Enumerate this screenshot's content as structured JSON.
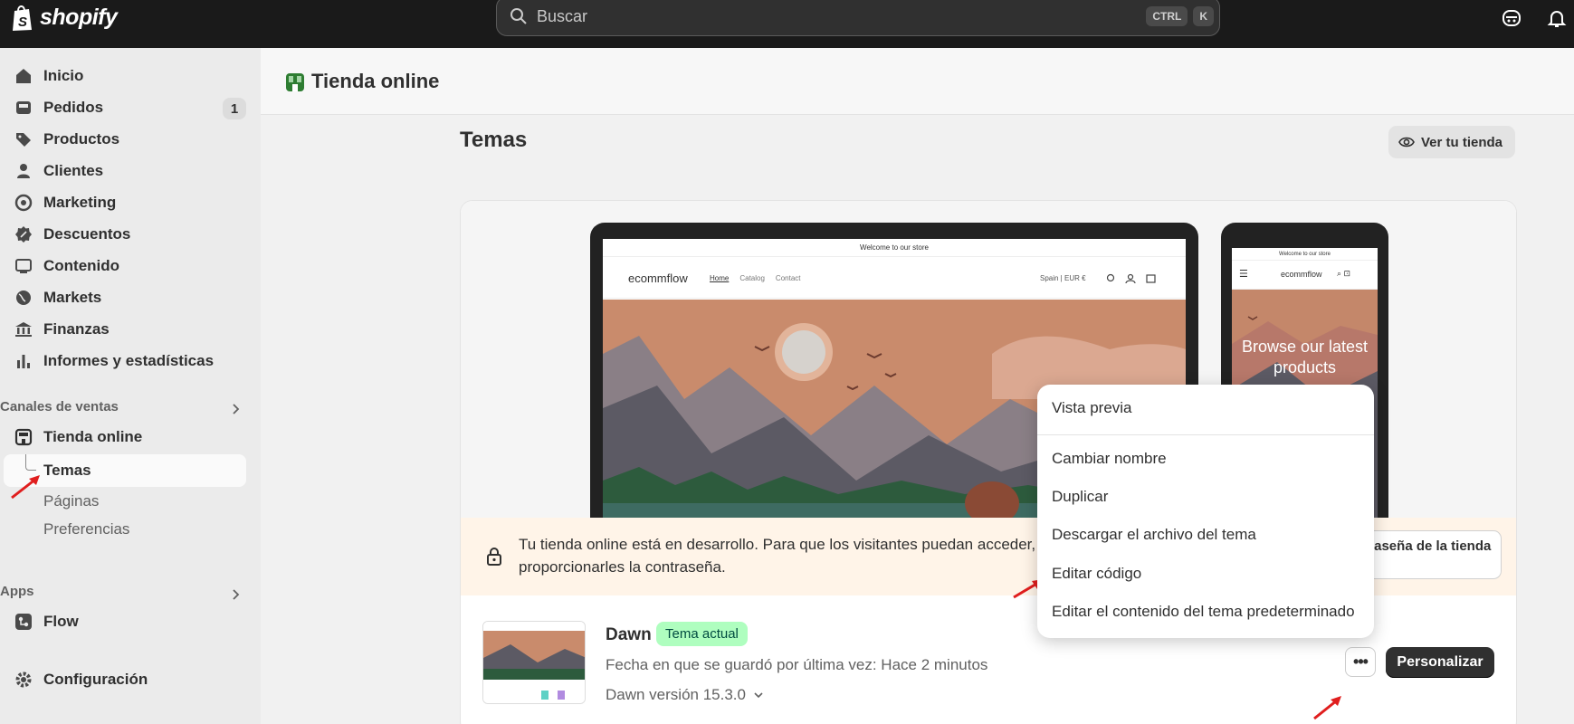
{
  "topbar": {
    "brand": "shopify",
    "search_placeholder": "Buscar",
    "shortcut_key1": "CTRL",
    "shortcut_key2": "K"
  },
  "sidebar": {
    "items": [
      {
        "label": "Inicio",
        "icon": "home-icon"
      },
      {
        "label": "Pedidos",
        "icon": "orders-icon",
        "badge": "1"
      },
      {
        "label": "Productos",
        "icon": "tag-icon"
      },
      {
        "label": "Clientes",
        "icon": "person-icon"
      },
      {
        "label": "Marketing",
        "icon": "target-icon"
      },
      {
        "label": "Descuentos",
        "icon": "discount-icon"
      },
      {
        "label": "Contenido",
        "icon": "content-icon"
      },
      {
        "label": "Markets",
        "icon": "globe-icon"
      },
      {
        "label": "Finanzas",
        "icon": "bank-icon"
      },
      {
        "label": "Informes y estadísticas",
        "icon": "chart-bar-icon"
      }
    ],
    "sales_channels_label": "Canales de ventas",
    "online_store_label": "Tienda online",
    "sub_items": [
      "Temas",
      "Páginas",
      "Preferencias"
    ],
    "apps_label": "Apps",
    "flow_label": "Flow",
    "settings_label": "Configuración"
  },
  "page": {
    "header_title": "Tienda online",
    "section_title": "Temas",
    "view_store_button": "Ver tu tienda"
  },
  "preview": {
    "announcement": "Welcome to our store",
    "store_name": "ecommflow",
    "nav_links": [
      "Home",
      "Catalog",
      "Contact"
    ],
    "locale": "Spain | EUR €",
    "mobile_hero_text": "Browse our latest products"
  },
  "banner": {
    "message": "Tu tienda online está en desarrollo. Para que los visitantes puedan acceder, proporcionarles la contraseña.",
    "button_label": "contraseña de la tienda"
  },
  "theme": {
    "name": "Dawn",
    "current_tag": "Tema actual",
    "last_saved": "Fecha en que se guardó por última vez: Hace 2 minutos",
    "version": "Dawn versión 15.3.0",
    "more_button": "•••",
    "customize_button": "Personalizar"
  },
  "menu": {
    "items": [
      "Vista previa",
      "Cambiar nombre",
      "Duplicar",
      "Descargar el archivo del tema",
      "Editar código",
      "Editar el contenido del tema predeterminado"
    ]
  },
  "colors": {
    "topbar": "#1a1a1a",
    "sidebar": "#ebebeb",
    "accent_tag": "#affebf",
    "banner": "#fff4e8",
    "primary_button": "#303030",
    "annotation_arrow": "#e01e1e"
  }
}
